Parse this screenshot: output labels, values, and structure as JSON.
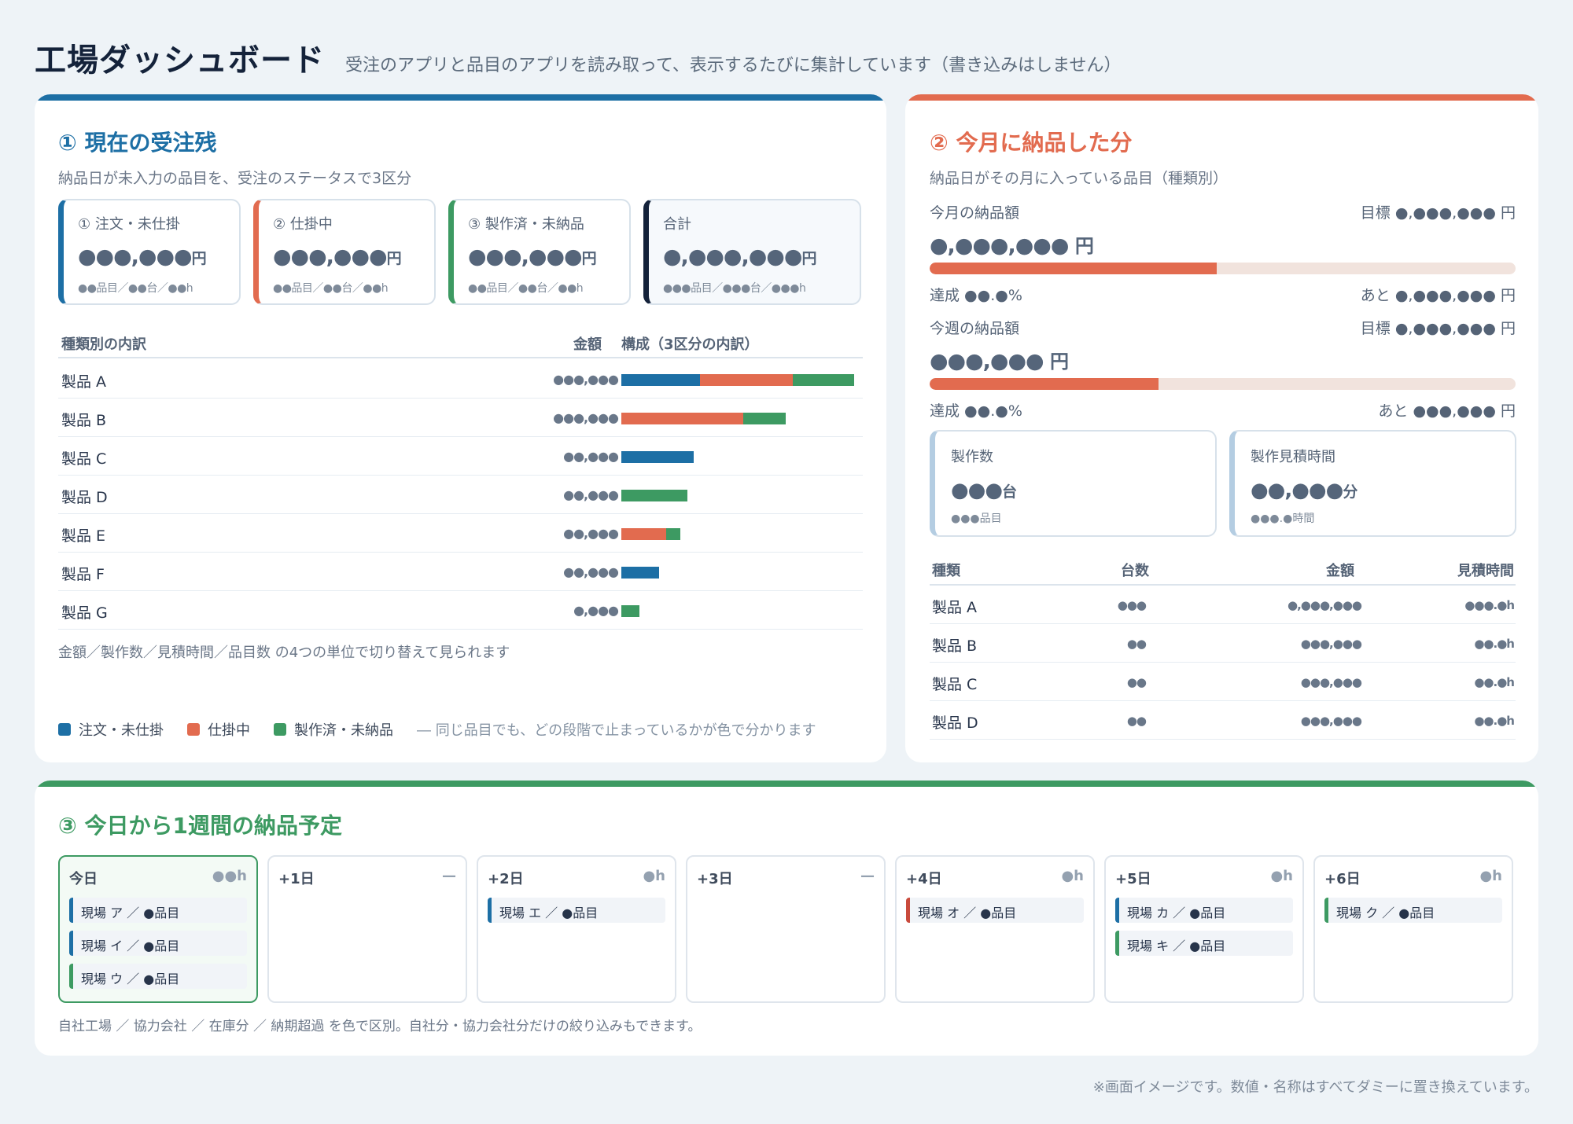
{
  "header": {
    "title": "工場ダッシュボード",
    "subtitle": "受注のアプリと品目のアプリを読み取って、表示するたびに集計しています（書き込みはしません）"
  },
  "colors": {
    "blue": "#1d6fa5",
    "orange": "#e26b4f",
    "green": "#3d9a62",
    "navy": "#14223a",
    "red": "#c94a3c"
  },
  "section1": {
    "title": "① 現在の受注残",
    "subtitle": "納品日が未入力の品目を、受注のステータスで3区分",
    "tiles": [
      {
        "label": "① 注文・未仕掛",
        "value": "●●●,●●●",
        "unit": "円",
        "meta": "●●品目／●●台／●●h",
        "color": "#1d6fa5"
      },
      {
        "label": "② 仕掛中",
        "value": "●●●,●●●",
        "unit": "円",
        "meta": "●●品目／●●台／●●h",
        "color": "#e26b4f"
      },
      {
        "label": "③ 製作済・未納品",
        "value": "●●●,●●●",
        "unit": "円",
        "meta": "●●品目／●●台／●●h",
        "color": "#3d9a62"
      },
      {
        "label": "合計",
        "value": "●,●●●,●●●",
        "unit": "円",
        "meta": "●●●品目／●●●台／●●●h",
        "color": "#14223a"
      }
    ],
    "breakdown_header": {
      "name": "種類別の内訳",
      "amount": "金額",
      "composition": "構成（3区分の内訳）"
    },
    "rows": [
      {
        "name": "製品 A",
        "amount": "●●●,●●●",
        "segments": [
          100,
          118,
          78
        ]
      },
      {
        "name": "製品 B",
        "amount": "●●●,●●●",
        "segments": [
          0,
          155,
          54
        ]
      },
      {
        "name": "製品 C",
        "amount": "●●,●●●",
        "segments": [
          92,
          0,
          0
        ]
      },
      {
        "name": "製品 D",
        "amount": "●●,●●●",
        "segments": [
          0,
          0,
          84
        ]
      },
      {
        "name": "製品 E",
        "amount": "●●,●●●",
        "segments": [
          0,
          57,
          18
        ]
      },
      {
        "name": "製品 F",
        "amount": "●●,●●●",
        "segments": [
          48,
          0,
          0
        ]
      },
      {
        "name": "製品 G",
        "amount": "●,●●●",
        "segments": [
          0,
          0,
          23
        ]
      }
    ],
    "note": "金額／製作数／見積時間／品目数 の4つの単位で切り替えて見られます",
    "legend": [
      {
        "label": "注文・未仕掛",
        "color": "#1d6fa5"
      },
      {
        "label": "仕掛中",
        "color": "#e26b4f"
      },
      {
        "label": "製作済・未納品",
        "color": "#3d9a62"
      }
    ],
    "legend_note": "― 同じ品目でも、どの段階で止まっているかが色で分かります"
  },
  "section2": {
    "title": "② 今月に納品した分",
    "subtitle": "納品日がその月に入っている品目（種類別）",
    "month": {
      "label": "今月の納品額",
      "target": "目標 ●,●●●,●●● 円",
      "value": "●,●●●,●●●",
      "unit": "円",
      "progress": 0.49,
      "rate": "達成 ●●.●%",
      "remaining": "あと ●,●●●,●●● 円"
    },
    "week": {
      "label": "今週の納品額",
      "target": "目標 ●,●●●,●●● 円",
      "value": "●●●,●●●",
      "unit": "円",
      "progress": 0.39,
      "rate": "達成 ●●.●%",
      "remaining": "あと ●●●,●●● 円"
    },
    "mini": [
      {
        "label": "製作数",
        "value": "●●●",
        "unit": "台",
        "meta": "●●●品目"
      },
      {
        "label": "製作見積時間",
        "value": "●●,●●●",
        "unit": "分",
        "meta": "●●●.●時間"
      }
    ],
    "table_header": {
      "type": "種類",
      "count": "台数",
      "amount": "金額",
      "hours": "見積時間"
    },
    "table": [
      {
        "type": "製品 A",
        "count": "●●●",
        "amount": "●,●●●,●●●",
        "hours": "●●●.●h"
      },
      {
        "type": "製品 B",
        "count": "●●",
        "amount": "●●●,●●●",
        "hours": "●●.●h"
      },
      {
        "type": "製品 C",
        "count": "●●",
        "amount": "●●●,●●●",
        "hours": "●●.●h"
      },
      {
        "type": "製品 D",
        "count": "●●",
        "amount": "●●●,●●●",
        "hours": "●●.●h"
      }
    ]
  },
  "section3": {
    "title": "③ 今日から1週間の納品予定",
    "days": [
      {
        "label": "今日",
        "hours": "●●h",
        "jobs": [
          {
            "text": "現場 ア ／ ●品目",
            "color": "#1d6fa5"
          },
          {
            "text": "現場 イ ／ ●品目",
            "color": "#1d6fa5"
          },
          {
            "text": "現場 ウ ／ ●品目",
            "color": "#3d9a62"
          }
        ]
      },
      {
        "label": "+1日",
        "hours": "—",
        "jobs": []
      },
      {
        "label": "+2日",
        "hours": "●h",
        "jobs": [
          {
            "text": "現場 エ ／ ●品目",
            "color": "#1d6fa5"
          }
        ]
      },
      {
        "label": "+3日",
        "hours": "—",
        "jobs": []
      },
      {
        "label": "+4日",
        "hours": "●h",
        "jobs": [
          {
            "text": "現場 オ ／ ●品目",
            "color": "#c94a3c"
          }
        ]
      },
      {
        "label": "+5日",
        "hours": "●h",
        "jobs": [
          {
            "text": "現場 カ ／ ●品目",
            "color": "#1d6fa5"
          },
          {
            "text": "現場 キ ／ ●品目",
            "color": "#3d9a62"
          }
        ]
      },
      {
        "label": "+6日",
        "hours": "●h",
        "jobs": [
          {
            "text": "現場 ク ／ ●品目",
            "color": "#3d9a62"
          }
        ]
      }
    ],
    "note": "自社工場 ／ 協力会社 ／ 在庫分 ／ 納期超過 を色で区別。自社分・協力会社分だけの絞り込みもできます。"
  },
  "footnote": "※画面イメージです。数値・名称はすべてダミーに置き換えています。"
}
